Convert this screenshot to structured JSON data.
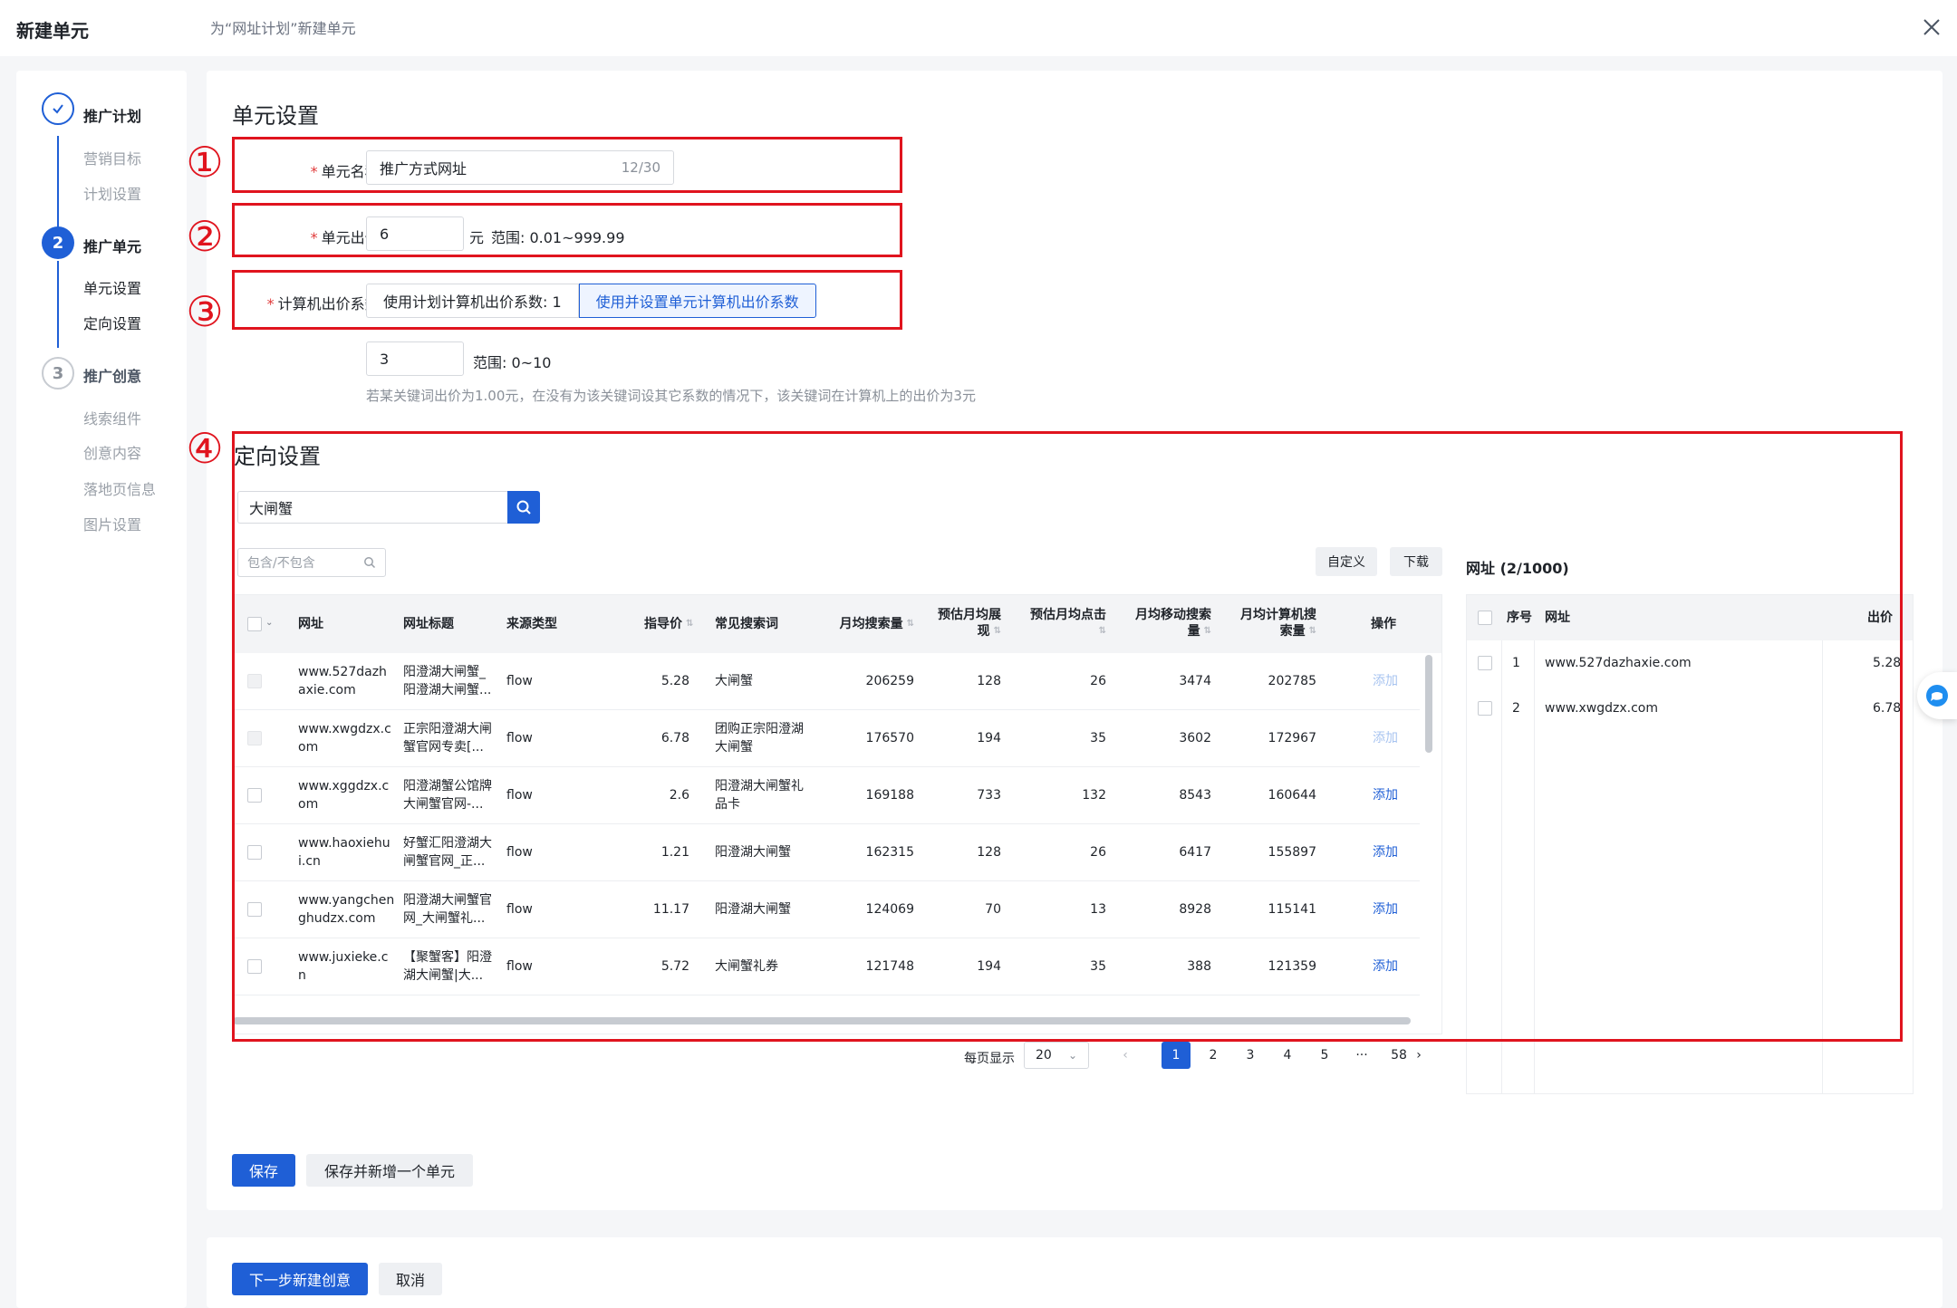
{
  "dialog": {
    "title": "新建单元",
    "subtitle": "为“网址计划”新建单元"
  },
  "stepper": {
    "steps": [
      {
        "index": "✓",
        "label": "推广计划",
        "subs": [
          "营销目标",
          "计划设置"
        ]
      },
      {
        "index": "2",
        "label": "推广单元",
        "subs": [
          "单元设置",
          "定向设置"
        ]
      },
      {
        "index": "3",
        "label": "推广创意",
        "subs": [
          "线索组件",
          "创意内容",
          "落地页信息",
          "图片设置"
        ]
      }
    ]
  },
  "unit_settings": {
    "title": "单元设置",
    "name_label": "单元名称:",
    "name_value": "推广方式网址",
    "name_counter": "12/30",
    "bid_label": "单元出价:",
    "bid_value": "6",
    "bid_unit": "元",
    "bid_range": "范围: 0.01~999.99",
    "coef_label": "计算机出价系数:",
    "coef_option_plan": "使用计划计算机出价系数: 1",
    "coef_option_unit": "使用并设置单元计算机出价系数",
    "coef_value": "3",
    "coef_range": "范围: 0~10",
    "coef_hint": "若某关键词出价为1.00元，在没有为该关键词设其它系数的情况下，该关键词在计算机上的出价为3元"
  },
  "annotations": [
    "①",
    "②",
    "③",
    "④"
  ],
  "targeting": {
    "title": "定向设置",
    "search_value": "大闸蟹",
    "filter_placeholder": "包含/不包含",
    "customize_label": "自定义",
    "download_label": "下载",
    "columns": [
      "网址",
      "网址标题",
      "来源类型",
      "指导价",
      "常见搜索词",
      "月均搜索量",
      "预估月均展现",
      "预估月均点击",
      "月均移动搜索量",
      "月均计算机搜索量",
      "操作"
    ],
    "rows": [
      {
        "url": [
          "www.527dazh",
          "axie.com"
        ],
        "title": [
          "阳澄湖大闸蟹_",
          "阳澄湖大闸蟹..."
        ],
        "source": "flow",
        "price": "5.28",
        "term": [
          "大闸蟹"
        ],
        "monthly": "206259",
        "impr": "128",
        "clicks": "26",
        "mobile": "3474",
        "pc": "202785",
        "action": "添加",
        "added": true
      },
      {
        "url": [
          "www.xwgdzx.c",
          "om"
        ],
        "title": [
          "正宗阳澄湖大闸",
          "蟹官网专卖[..."
        ],
        "source": "flow",
        "price": "6.78",
        "term": [
          "团购正宗阳澄湖",
          "大闸蟹"
        ],
        "monthly": "176570",
        "impr": "194",
        "clicks": "35",
        "mobile": "3602",
        "pc": "172967",
        "action": "添加",
        "added": true
      },
      {
        "url": [
          "www.xggdzx.c",
          "om"
        ],
        "title": [
          "阳澄湖蟹公馆牌",
          "大闸蟹官网-..."
        ],
        "source": "flow",
        "price": "2.6",
        "term": [
          "阳澄湖大闸蟹礼",
          "品卡"
        ],
        "monthly": "169188",
        "impr": "733",
        "clicks": "132",
        "mobile": "8543",
        "pc": "160644",
        "action": "添加",
        "added": false
      },
      {
        "url": [
          "www.haoxiehu",
          "i.cn"
        ],
        "title": [
          "好蟹汇阳澄湖大",
          "闸蟹官网_正..."
        ],
        "source": "flow",
        "price": "1.21",
        "term": [
          "阳澄湖大闸蟹"
        ],
        "monthly": "162315",
        "impr": "128",
        "clicks": "26",
        "mobile": "6417",
        "pc": "155897",
        "action": "添加",
        "added": false
      },
      {
        "url": [
          "www.yangchen",
          "ghudzx.com"
        ],
        "title": [
          "阳澄湖大闸蟹官",
          "网_大闸蟹礼..."
        ],
        "source": "flow",
        "price": "11.17",
        "term": [
          "阳澄湖大闸蟹"
        ],
        "monthly": "124069",
        "impr": "70",
        "clicks": "13",
        "mobile": "8928",
        "pc": "115141",
        "action": "添加",
        "added": false
      },
      {
        "url": [
          "www.juxieke.c",
          "n"
        ],
        "title": [
          "【聚蟹客】阳澄",
          "湖大闸蟹|大..."
        ],
        "source": "flow",
        "price": "5.72",
        "term": [
          "大闸蟹礼券"
        ],
        "monthly": "121748",
        "impr": "194",
        "clicks": "35",
        "mobile": "388",
        "pc": "121359",
        "action": "添加",
        "added": false
      }
    ],
    "pager": {
      "per_page_label": "每页显示",
      "per_page_value": "20",
      "prev": "‹",
      "pages": [
        "1",
        "2",
        "3",
        "4",
        "5",
        "···",
        "58"
      ],
      "next": "›"
    }
  },
  "selected": {
    "title": "网址 (2/1000)",
    "columns": [
      "序号",
      "网址",
      "出价"
    ],
    "rows": [
      {
        "index": "1",
        "url": "www.527dazhaxie.com",
        "bid": "5.28"
      },
      {
        "index": "2",
        "url": "www.xwgdzx.com",
        "bid": "6.78"
      }
    ]
  },
  "actions": {
    "save": "保存",
    "save_and_new": "保存并新增一个单元",
    "next": "下一步新建创意",
    "cancel": "取消"
  },
  "colors": {
    "primary": "#1f5fd6",
    "annotation_red": "#e0141e"
  }
}
